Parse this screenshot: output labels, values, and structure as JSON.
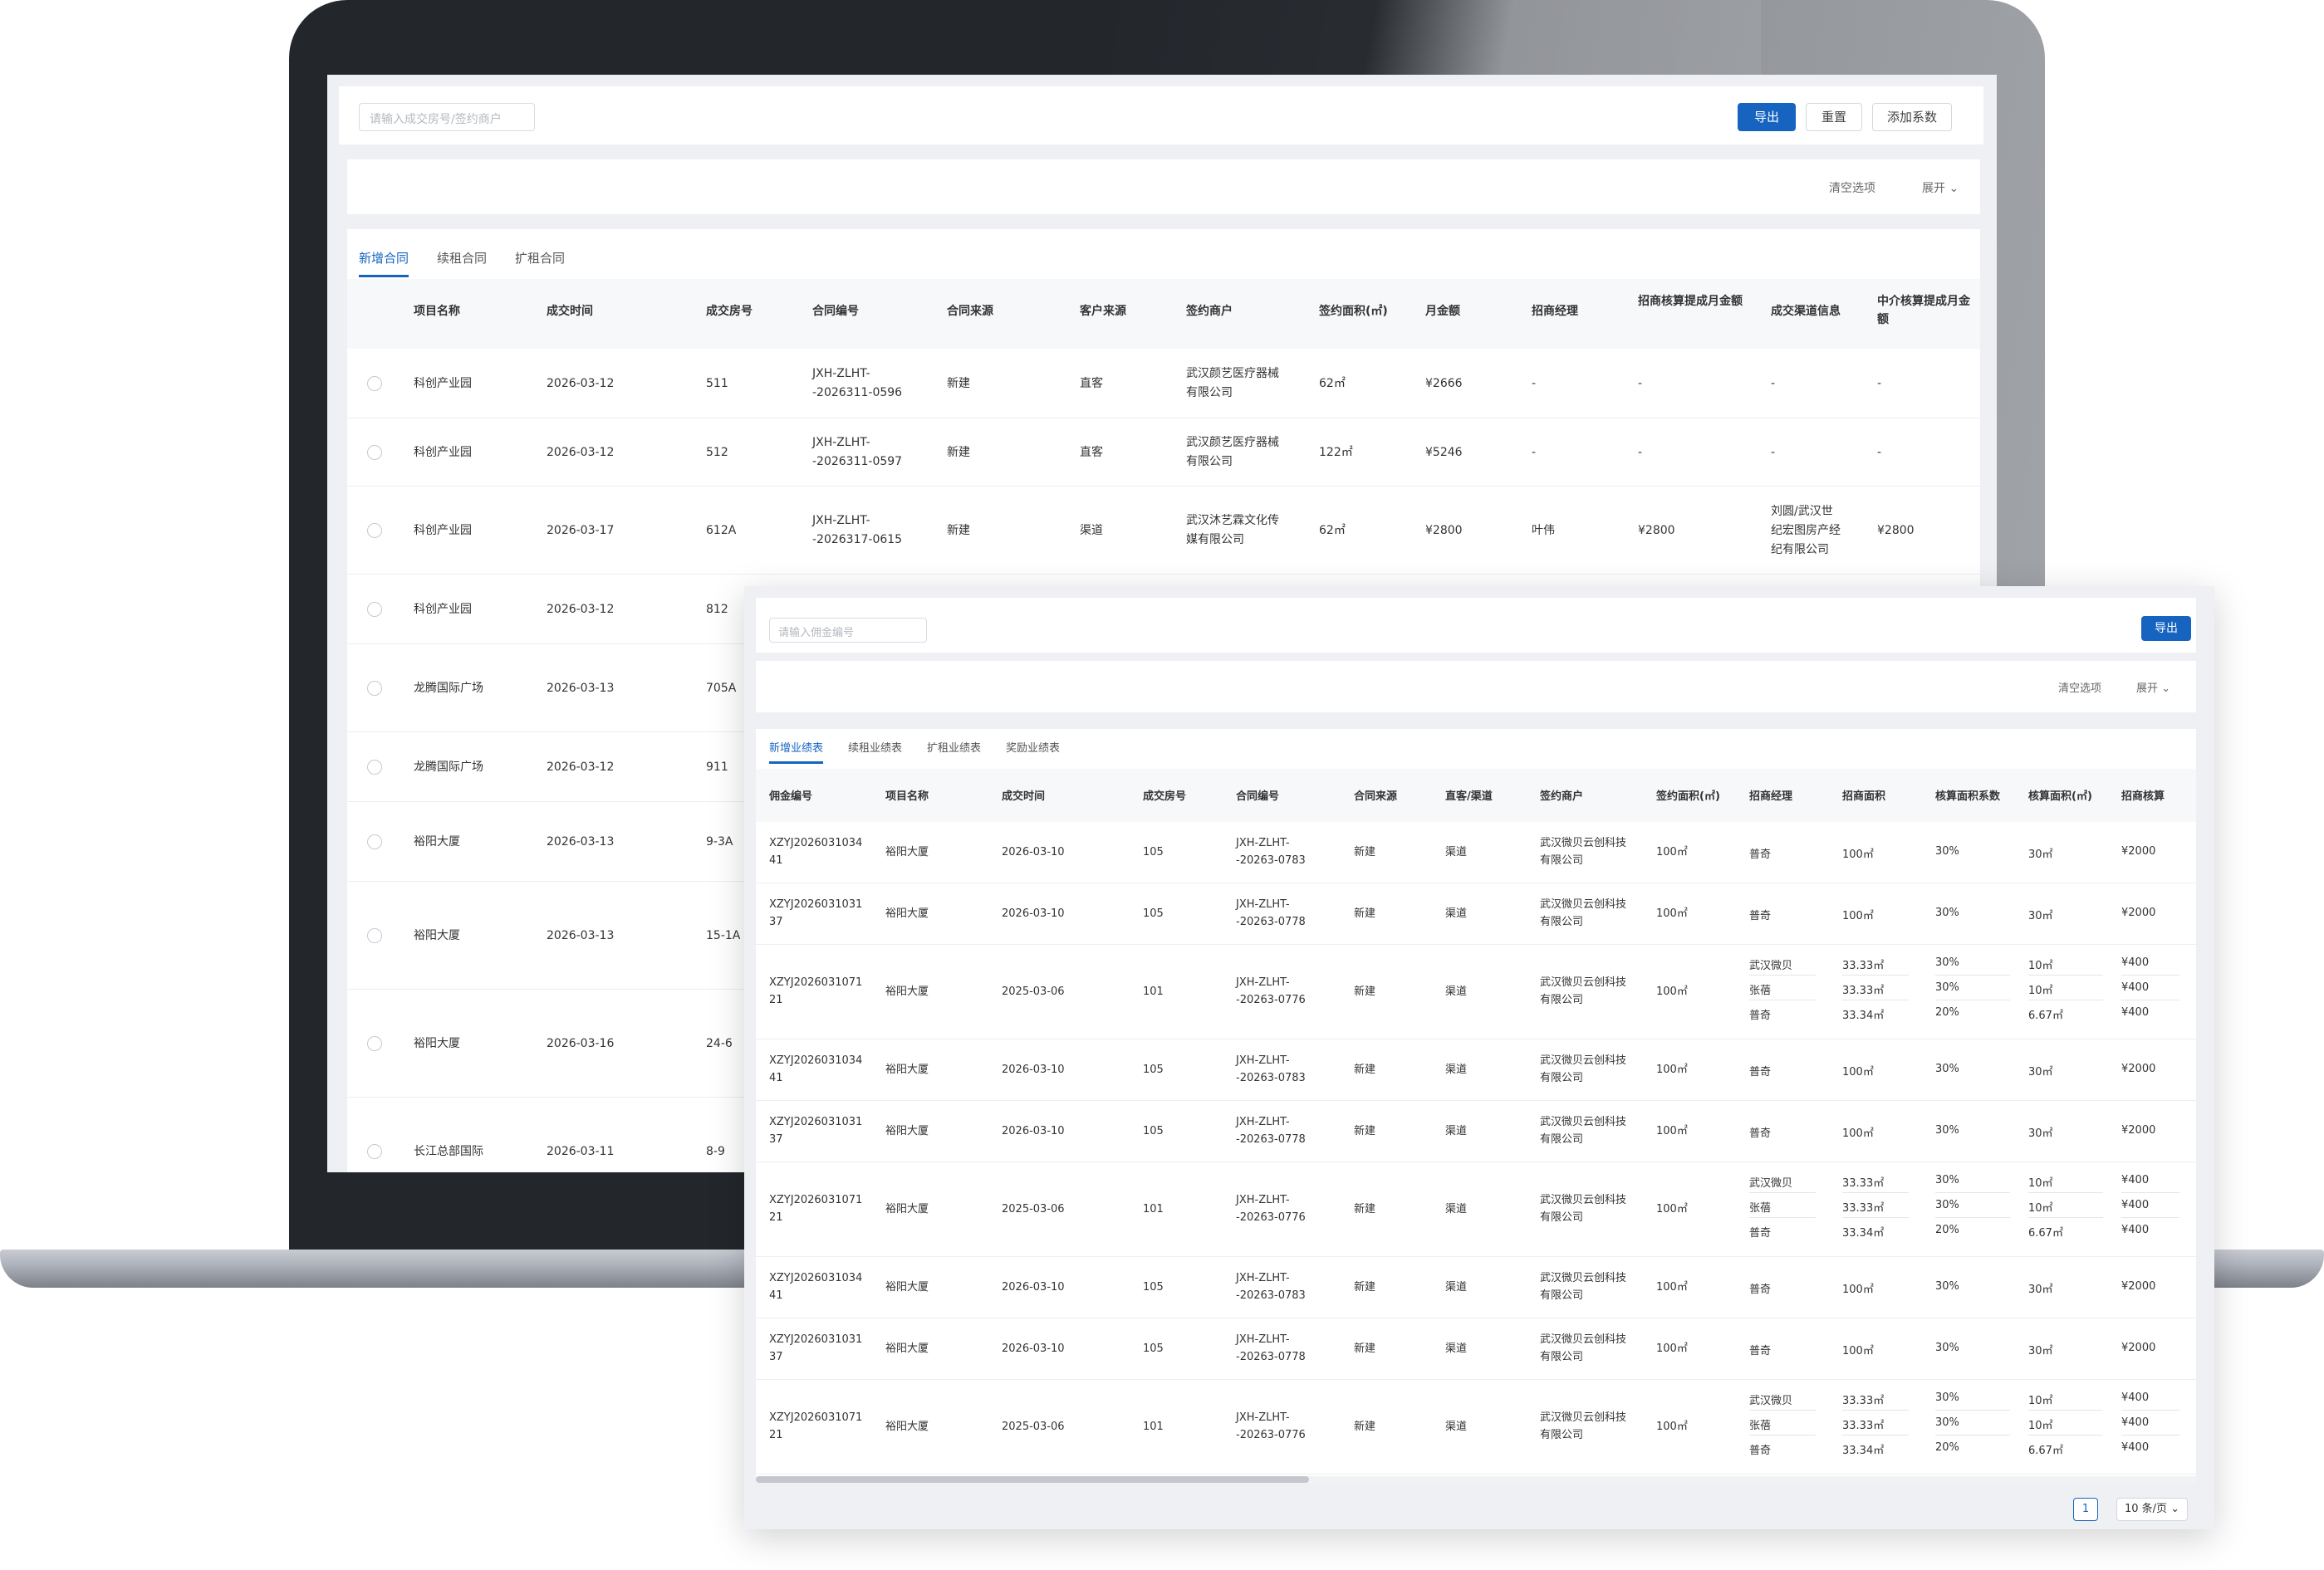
{
  "screen1": {
    "search_placeholder": "请输入成交房号/签约商户",
    "buttons": {
      "export": "导出",
      "reset": "重置",
      "add_coefficient": "添加系数"
    },
    "filter": {
      "clear": "清空选项",
      "expand": "展开"
    },
    "tabs": [
      "新增合同",
      "续租合同",
      "扩租合同"
    ],
    "columns": [
      "项目名称",
      "成交时间",
      "成交房号",
      "合同编号",
      "合同来源",
      "客户来源",
      "签约商户",
      "签约面积(㎡)",
      "月金额",
      "招商经理",
      "招商核算提成月金额",
      "成交渠道信息",
      "中介核算提成月金额"
    ],
    "rows": [
      [
        "科创产业园",
        "2026-03-12",
        "511",
        "JXH-ZLHT-\n-2026311-0596",
        "新建",
        "直客",
        "武汉颜艺医疗器械\n有限公司",
        "62㎡",
        "¥2666",
        "-",
        "-",
        "-",
        "-"
      ],
      [
        "科创产业园",
        "2026-03-12",
        "512",
        "JXH-ZLHT-\n-2026311-0597",
        "新建",
        "直客",
        "武汉颜艺医疗器械\n有限公司",
        "122㎡",
        "¥5246",
        "-",
        "-",
        "-",
        "-"
      ],
      [
        "科创产业园",
        "2026-03-17",
        "612A",
        "JXH-ZLHT-\n-2026317-0615",
        "新建",
        "渠道",
        "武汉沐艺霖文化传\n媒有限公司",
        "62㎡",
        "¥2800",
        "叶伟",
        "¥2800",
        "刘圆/武汉世\n纪宏图房产经\n纪有限公司",
        "¥2800"
      ],
      [
        "科创产业园",
        "2026-03-12",
        "812",
        "",
        "",
        "",
        "",
        "",
        "",
        "",
        "",
        "",
        ""
      ],
      [
        "龙腾国际广场",
        "2026-03-13",
        "705A",
        "",
        "",
        "",
        "",
        "",
        "",
        "",
        "",
        "",
        ""
      ],
      [
        "龙腾国际广场",
        "2026-03-12",
        "911",
        "",
        "",
        "",
        "",
        "",
        "",
        "",
        "",
        "",
        ""
      ],
      [
        "裕阳大厦",
        "2026-03-13",
        "9-3A",
        "",
        "",
        "",
        "",
        "",
        "",
        "",
        "",
        "",
        ""
      ],
      [
        "裕阳大厦",
        "2026-03-13",
        "15-1A",
        "",
        "",
        "",
        "",
        "",
        "",
        "",
        "",
        "",
        ""
      ],
      [
        "裕阳大厦",
        "2026-03-16",
        "24-6",
        "",
        "",
        "",
        "",
        "",
        "",
        "",
        "",
        "",
        ""
      ],
      [
        "长江总部国际",
        "2026-03-11",
        "8-9",
        "",
        "",
        "",
        "",
        "",
        "",
        "",
        "",
        "",
        ""
      ]
    ]
  },
  "screen2": {
    "search_placeholder": "请输入佣金编号",
    "buttons": {
      "export": "导出"
    },
    "filter": {
      "clear": "清空选项",
      "expand": "展开"
    },
    "tabs": [
      "新增业绩表",
      "续租业绩表",
      "扩租业绩表",
      "奖励业绩表"
    ],
    "columns": [
      "佣金编号",
      "项目名称",
      "成交时间",
      "成交房号",
      "合同编号",
      "合同来源",
      "直客/渠道",
      "签约商户",
      "签约面积(㎡)",
      "招商经理",
      "招商面积",
      "核算面积系数",
      "核算面积(㎡)",
      "招商核算"
    ],
    "rows": [
      {
        "id": "XZYJ2026031034\n41",
        "project": "裕阳大厦",
        "date": "2026-03-10",
        "room": "105",
        "contract": "JXH-ZLHT-\n-20263-0783",
        "source": "新建",
        "channel": "渠道",
        "merchant": "武汉微贝云创科技\n有限公司",
        "area": "100㎡",
        "subs": [
          [
            "普奇",
            "100㎡",
            "30%",
            "30㎡",
            "¥2000"
          ]
        ]
      },
      {
        "id": "XZYJ2026031031\n37",
        "project": "裕阳大厦",
        "date": "2026-03-10",
        "room": "105",
        "contract": "JXH-ZLHT-\n-20263-0778",
        "source": "新建",
        "channel": "渠道",
        "merchant": "武汉微贝云创科技\n有限公司",
        "area": "100㎡",
        "subs": [
          [
            "普奇",
            "100㎡",
            "30%",
            "30㎡",
            "¥2000"
          ]
        ]
      },
      {
        "id": "XZYJ2026031071\n21",
        "project": "裕阳大厦",
        "date": "2025-03-06",
        "room": "101",
        "contract": "JXH-ZLHT-\n-20263-0776",
        "source": "新建",
        "channel": "渠道",
        "merchant": "武汉微贝云创科技\n有限公司",
        "area": "100㎡",
        "subs": [
          [
            "武汉微贝",
            "33.33㎡",
            "30%",
            "10㎡",
            "¥400"
          ],
          [
            "张蓓",
            "33.33㎡",
            "30%",
            "10㎡",
            "¥400"
          ],
          [
            "普奇",
            "33.34㎡",
            "20%",
            "6.67㎡",
            "¥400"
          ]
        ]
      },
      {
        "id": "XZYJ2026031034\n41",
        "project": "裕阳大厦",
        "date": "2026-03-10",
        "room": "105",
        "contract": "JXH-ZLHT-\n-20263-0783",
        "source": "新建",
        "channel": "渠道",
        "merchant": "武汉微贝云创科技\n有限公司",
        "area": "100㎡",
        "subs": [
          [
            "普奇",
            "100㎡",
            "30%",
            "30㎡",
            "¥2000"
          ]
        ]
      },
      {
        "id": "XZYJ2026031031\n37",
        "project": "裕阳大厦",
        "date": "2026-03-10",
        "room": "105",
        "contract": "JXH-ZLHT-\n-20263-0778",
        "source": "新建",
        "channel": "渠道",
        "merchant": "武汉微贝云创科技\n有限公司",
        "area": "100㎡",
        "subs": [
          [
            "普奇",
            "100㎡",
            "30%",
            "30㎡",
            "¥2000"
          ]
        ]
      },
      {
        "id": "XZYJ2026031071\n21",
        "project": "裕阳大厦",
        "date": "2025-03-06",
        "room": "101",
        "contract": "JXH-ZLHT-\n-20263-0776",
        "source": "新建",
        "channel": "渠道",
        "merchant": "武汉微贝云创科技\n有限公司",
        "area": "100㎡",
        "subs": [
          [
            "武汉微贝",
            "33.33㎡",
            "30%",
            "10㎡",
            "¥400"
          ],
          [
            "张蓓",
            "33.33㎡",
            "30%",
            "10㎡",
            "¥400"
          ],
          [
            "普奇",
            "33.34㎡",
            "20%",
            "6.67㎡",
            "¥400"
          ]
        ]
      },
      {
        "id": "XZYJ2026031034\n41",
        "project": "裕阳大厦",
        "date": "2026-03-10",
        "room": "105",
        "contract": "JXH-ZLHT-\n-20263-0783",
        "source": "新建",
        "channel": "渠道",
        "merchant": "武汉微贝云创科技\n有限公司",
        "area": "100㎡",
        "subs": [
          [
            "普奇",
            "100㎡",
            "30%",
            "30㎡",
            "¥2000"
          ]
        ]
      },
      {
        "id": "XZYJ2026031031\n37",
        "project": "裕阳大厦",
        "date": "2026-03-10",
        "room": "105",
        "contract": "JXH-ZLHT-\n-20263-0778",
        "source": "新建",
        "channel": "渠道",
        "merchant": "武汉微贝云创科技\n有限公司",
        "area": "100㎡",
        "subs": [
          [
            "普奇",
            "100㎡",
            "30%",
            "30㎡",
            "¥2000"
          ]
        ]
      },
      {
        "id": "XZYJ2026031071\n21",
        "project": "裕阳大厦",
        "date": "2025-03-06",
        "room": "101",
        "contract": "JXH-ZLHT-\n-20263-0776",
        "source": "新建",
        "channel": "渠道",
        "merchant": "武汉微贝云创科技\n有限公司",
        "area": "100㎡",
        "subs": [
          [
            "武汉微贝",
            "33.33㎡",
            "30%",
            "10㎡",
            "¥400"
          ],
          [
            "张蓓",
            "33.33㎡",
            "30%",
            "10㎡",
            "¥400"
          ],
          [
            "普奇",
            "33.34㎡",
            "20%",
            "6.67㎡",
            "¥400"
          ]
        ]
      }
    ],
    "pagination": {
      "current_page": "1",
      "page_size": "10 条/页"
    }
  },
  "colors": {
    "primary": "#1664c0"
  }
}
